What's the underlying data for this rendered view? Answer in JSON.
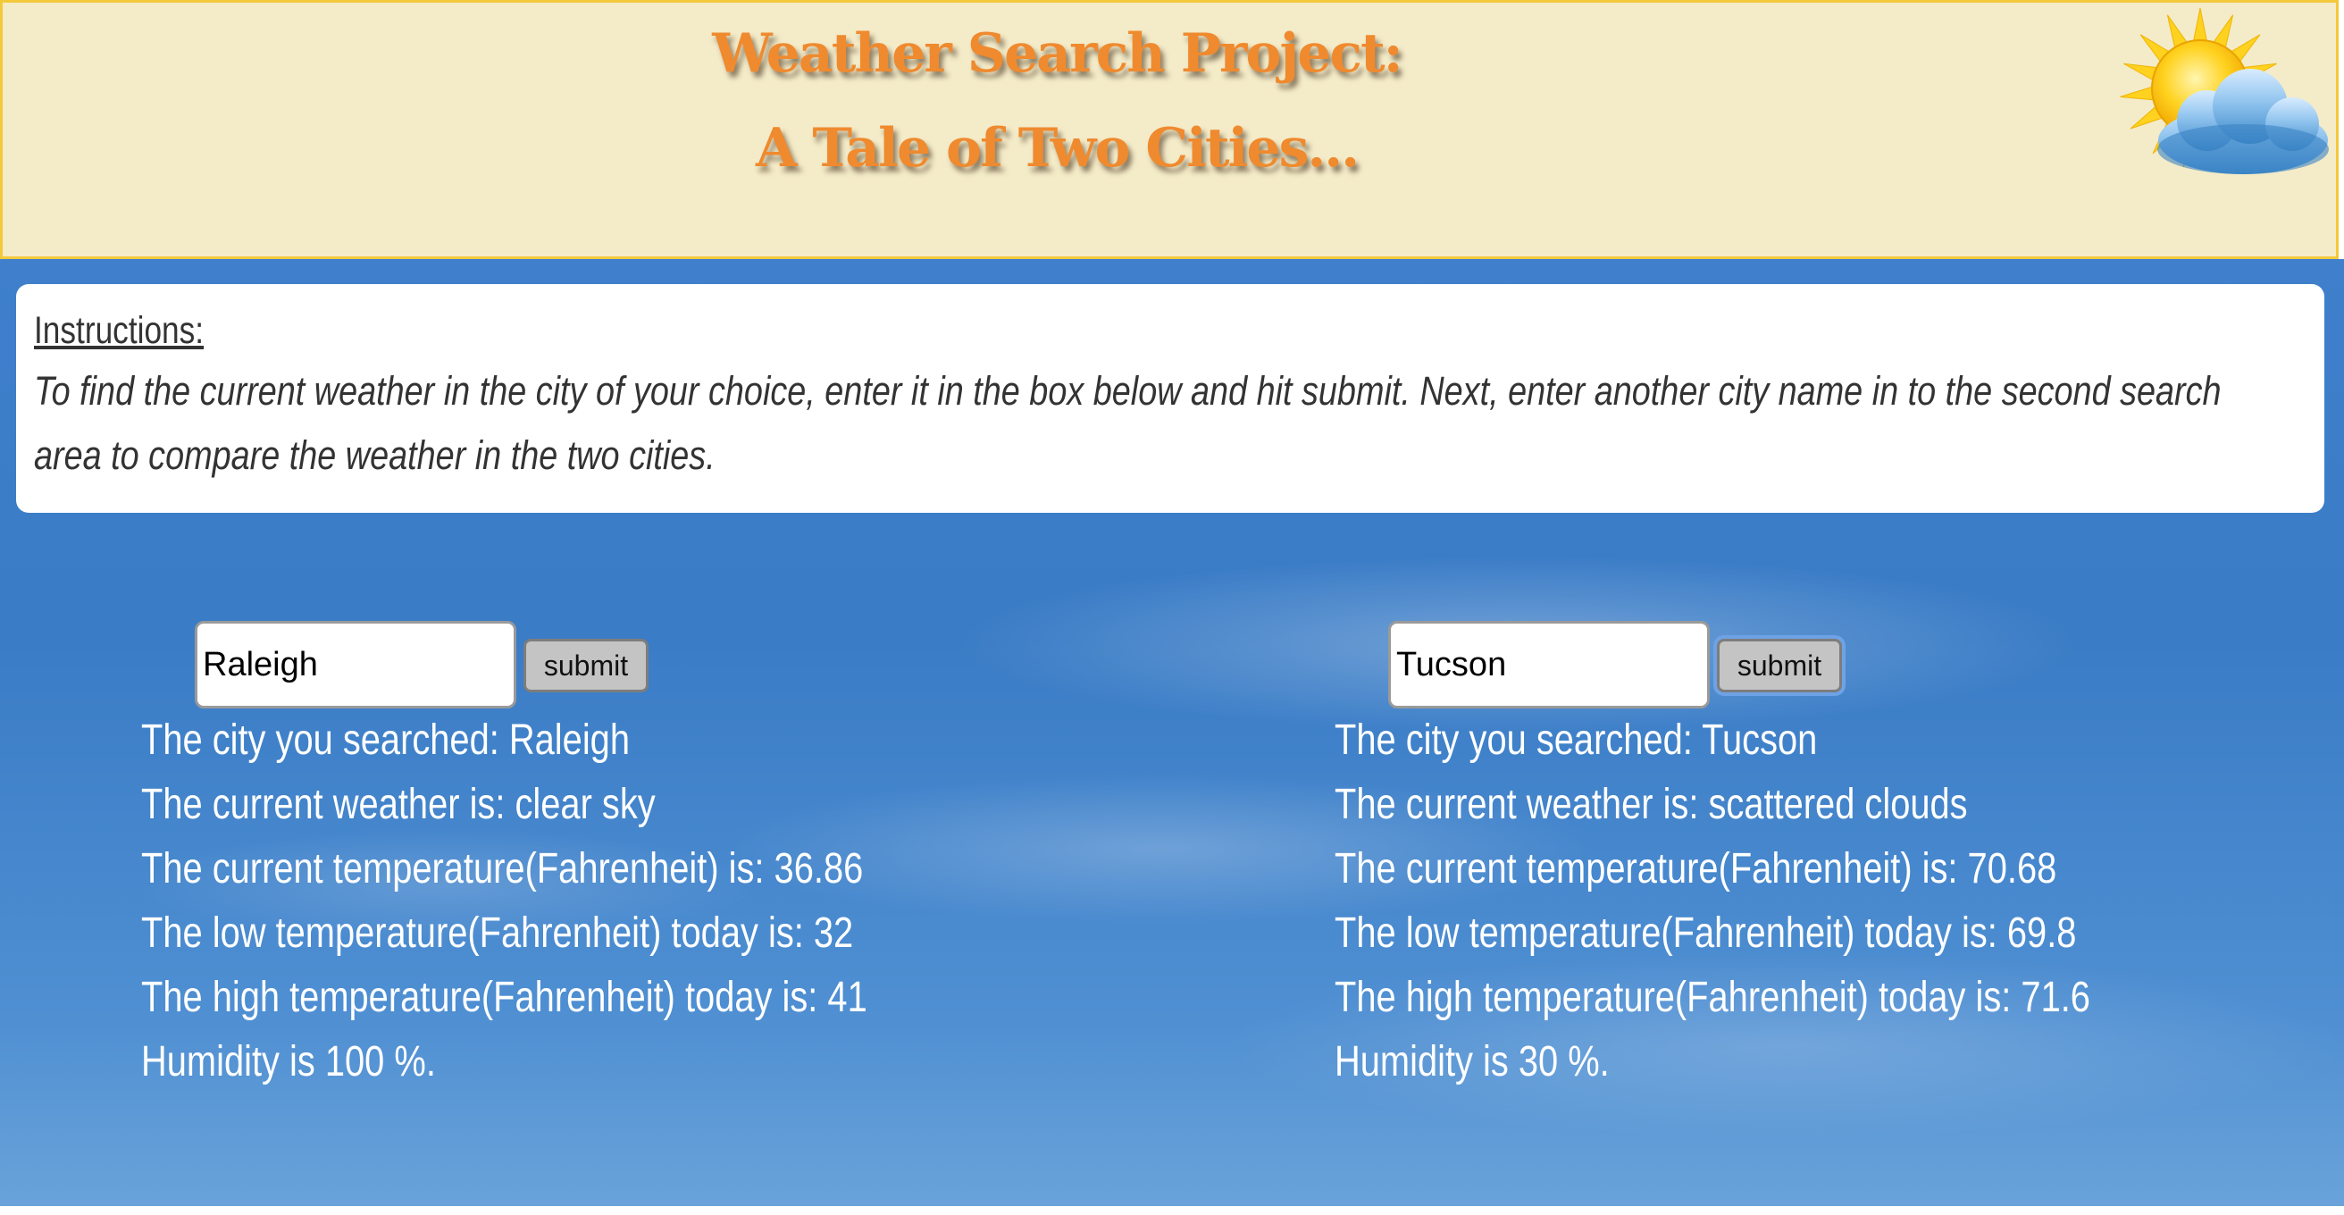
{
  "header": {
    "title_line1": "Weather Search Project:",
    "title_line2": "A Tale of Two Cities...",
    "logo_icon": "sun-behind-cloud-icon"
  },
  "instructions": {
    "heading": "Instructions:",
    "body": "To find the current weather in the city of your choice, enter it in the box below and hit submit. Next, enter another city name in to the second search area to compare the weather in the two cities."
  },
  "left": {
    "input_value": "Raleigh",
    "submit_label": "submit",
    "results": {
      "city": "The city you searched: Raleigh",
      "weather": "The current weather is: clear sky",
      "temp": "The current temperature(Fahrenheit) is: 36.86",
      "low": "The low temperature(Fahrenheit) today is: 32",
      "high": "The high temperature(Fahrenheit) today is: 41",
      "humidity": "Humidity is 100 %."
    }
  },
  "right": {
    "input_value": "Tucson",
    "submit_label": "submit",
    "results": {
      "city": "The city you searched: Tucson",
      "weather": "The current weather is: scattered clouds",
      "temp": "The current temperature(Fahrenheit) is: 70.68",
      "low": "The low temperature(Fahrenheit) today is: 69.8",
      "high": "The high temperature(Fahrenheit) today is: 71.6",
      "humidity": "Humidity is 30 %."
    }
  },
  "colors": {
    "header_bg": "#f4ebc8",
    "header_border": "#f2c93a",
    "title": "#ef8a2f",
    "sky": "#3a7cc6",
    "result_text": "#ffffff"
  }
}
